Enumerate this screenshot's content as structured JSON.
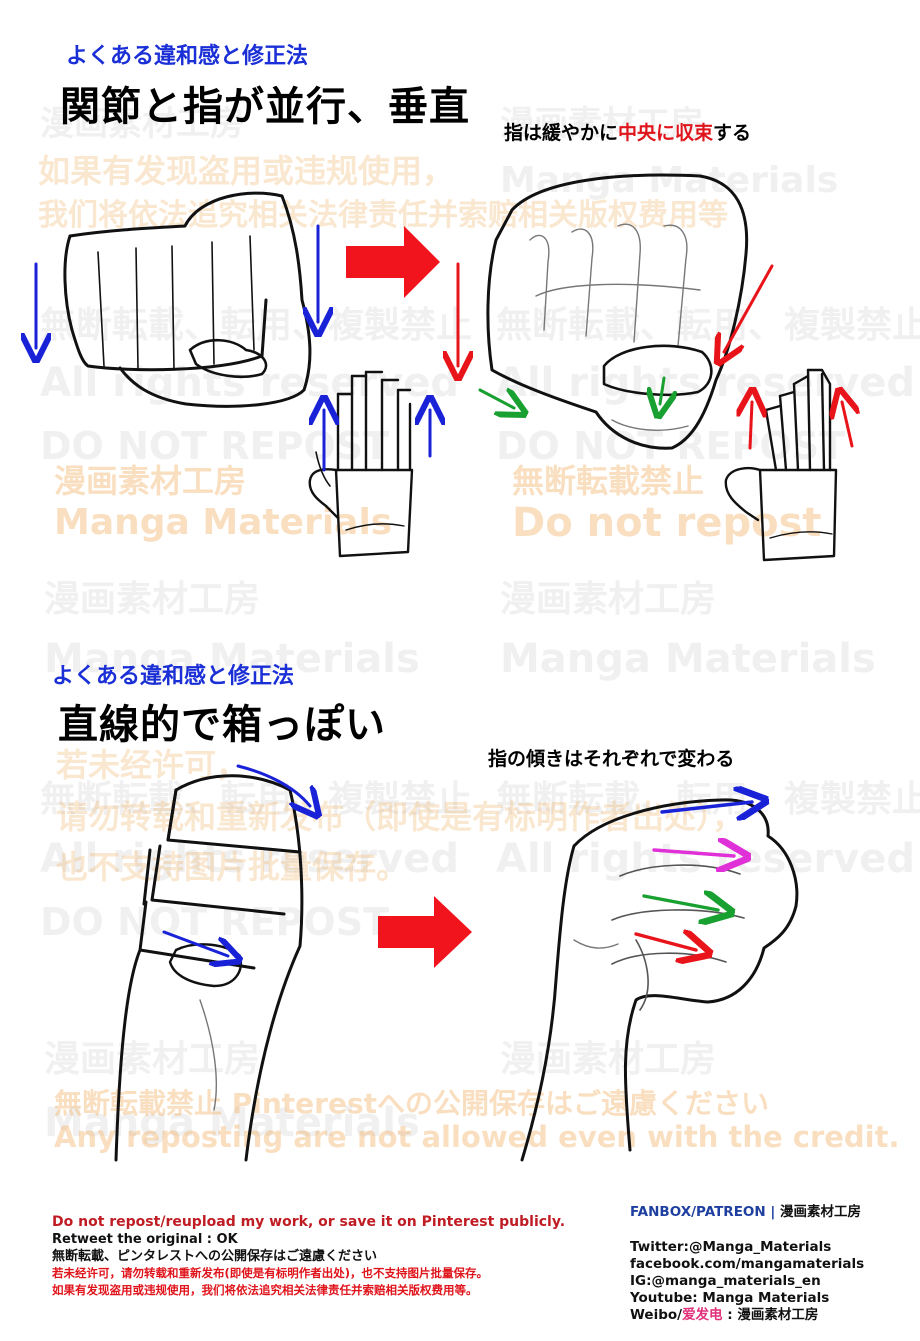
{
  "panel1": {
    "subtitle": "よくある違和感と修正法",
    "title": "関節と指が並行、垂直",
    "caption_prefix": "指は緩やかに",
    "caption_highlight": "中央に収束",
    "caption_suffix": "する"
  },
  "panel2": {
    "subtitle": "よくある違和感と修正法",
    "title": "直線的で箱っぽい",
    "caption": "指の傾きはそれぞれで変わる"
  },
  "watermarks": {
    "cn_line1": "如果有发现盗用或违规使用，",
    "cn_line2": "我们将依法追究相关法律责任并索赔相关版权费用等",
    "jp_no_repost": "無断転載、転用、複製禁止",
    "all_rights": "All rights reserved",
    "do_not_repost_caps": "DO NOT REPOST",
    "studio_name": "漫画素材工房",
    "manga_materials": "Manga Materials",
    "jp_no_repost_short": "無断転載禁止",
    "do_not_repost": "Do not repost",
    "cn2_line1": "若未经许可，",
    "cn2_line2": "请勿转载和重新发布（即使是有标明作者出处），",
    "cn2_line3": "也不支持图片批量保存。",
    "pinterest_jp": "無断転載禁止 Pinterestへの公開保存はご遠慮ください",
    "credit_en": "Any reposting are not allowed even with the credit."
  },
  "footer": {
    "left": {
      "line1": "Do not repost/reupload my work, or save it on Pinterest publicly.",
      "line2": "Retweet the original : OK",
      "line3": "無断転載、ピンタレストへの公開保存はご遠慮ください",
      "line4": "若未经许可，请勿转载和重新发布(即使是有标明作者出处)，也不支持图片批量保存。",
      "line5": "如果有发现盗用或违规使用，我们将依法追究相关法律责任并索赔相关版权费用等。"
    },
    "right": {
      "fanbox": "FANBOX/PATREON",
      "separator": " | ",
      "fanbox_name": "漫画素材工房",
      "twitter": "Twitter:@Manga_Materials",
      "facebook": "facebook.com/mangamaterials",
      "instagram": "IG:@manga_materials_en",
      "youtube": "Youtube: Manga Materials",
      "weibo_prefix": "Weibo/",
      "weibo_pink": "爱发电",
      "weibo_suffix": " : 漫画素材工房"
    }
  },
  "colors": {
    "blue_arrow": "#1a22d8",
    "red_arrow": "#e8141a",
    "green_arrow": "#18a030",
    "magenta_arrow": "#e030d8",
    "title_blue": "#1a2fd6"
  }
}
